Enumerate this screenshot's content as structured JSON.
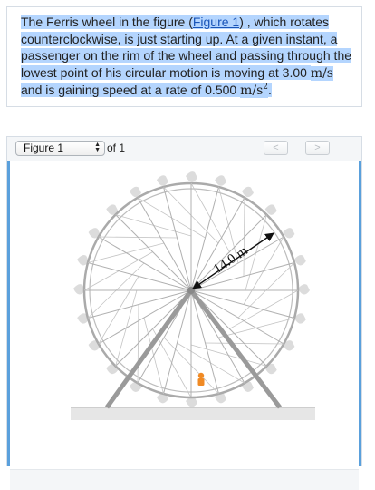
{
  "question": {
    "text_1": "The Ferris wheel in the figure (",
    "figure_link": "Figure 1",
    "text_2": ") , which rotates counterclockwise, is just starting up. At a given instant, a passenger on the rim of the wheel and passing through the lowest point of his circular motion is moving at 3.00 ",
    "unit_speed": "m/s",
    "text_3": " and is gaining speed at a rate of 0.500 ",
    "unit_accel": "m/s",
    "unit_accel_exp": "2",
    "text_end": "."
  },
  "figure_viewer": {
    "selected_figure": "Figure 1",
    "page_count": "of 1",
    "prev_glyph": "<",
    "next_glyph": ">"
  },
  "figure": {
    "radius_label": "14.0 m",
    "colors": {
      "wheel": "#aaaaaa",
      "support": "#9a9a9a",
      "gondola": "#d9d9d9",
      "ground": "#e6e6e6",
      "passenger": "#f08a24",
      "arrow": "#111111"
    }
  }
}
